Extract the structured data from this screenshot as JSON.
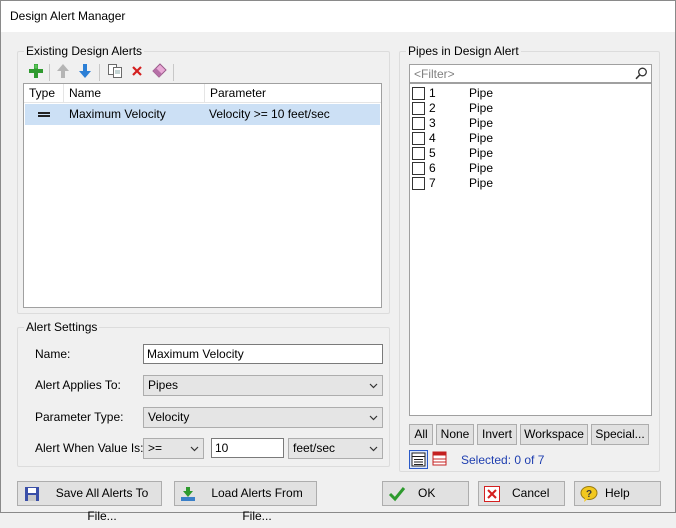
{
  "window": {
    "title": "Design Alert Manager"
  },
  "existing": {
    "group_label": "Existing Design Alerts",
    "toolbar": {
      "add_icon": "add-plus-icon",
      "up_icon": "arrow-up-icon",
      "down_icon": "arrow-down-icon",
      "copy_icon": "copy-icon",
      "delete_icon": "delete-x-icon",
      "clear_icon": "eraser-icon"
    },
    "columns": [
      "Type",
      "Name",
      "Parameter"
    ],
    "rows": [
      {
        "type_icon": "equals-icon",
        "name": "Maximum Velocity",
        "parameter": "Velocity >= 10 feet/sec"
      }
    ]
  },
  "settings": {
    "group_label": "Alert Settings",
    "name_label": "Name:",
    "name_value": "Maximum Velocity",
    "applies_label": "Alert Applies To:",
    "applies_value": "Pipes",
    "param_label": "Parameter Type:",
    "param_value": "Velocity",
    "when_label": "Alert When Value Is:",
    "operator_value": ">=",
    "threshold_value": "10",
    "unit_value": "feet/sec"
  },
  "pipes": {
    "group_label": "Pipes in Design Alert",
    "filter_placeholder": "<Filter>",
    "items": [
      {
        "id": "1",
        "name": "Pipe"
      },
      {
        "id": "2",
        "name": "Pipe"
      },
      {
        "id": "3",
        "name": "Pipe"
      },
      {
        "id": "4",
        "name": "Pipe"
      },
      {
        "id": "5",
        "name": "Pipe"
      },
      {
        "id": "6",
        "name": "Pipe"
      },
      {
        "id": "7",
        "name": "Pipe"
      }
    ],
    "buttons": {
      "all": "All",
      "none": "None",
      "invert": "Invert",
      "workspace": "Workspace",
      "special": "Special..."
    },
    "selected_text": "Selected: 0 of 7"
  },
  "footer": {
    "save_all": "Save All Alerts To File...",
    "load": "Load Alerts From File...",
    "ok": "OK",
    "cancel": "Cancel",
    "help": "Help"
  },
  "colors": {
    "selection": "#cce0f5",
    "ok_check": "#2e9a2e",
    "cancel_red": "#d42020",
    "selected_text": "#1f3fb0"
  }
}
